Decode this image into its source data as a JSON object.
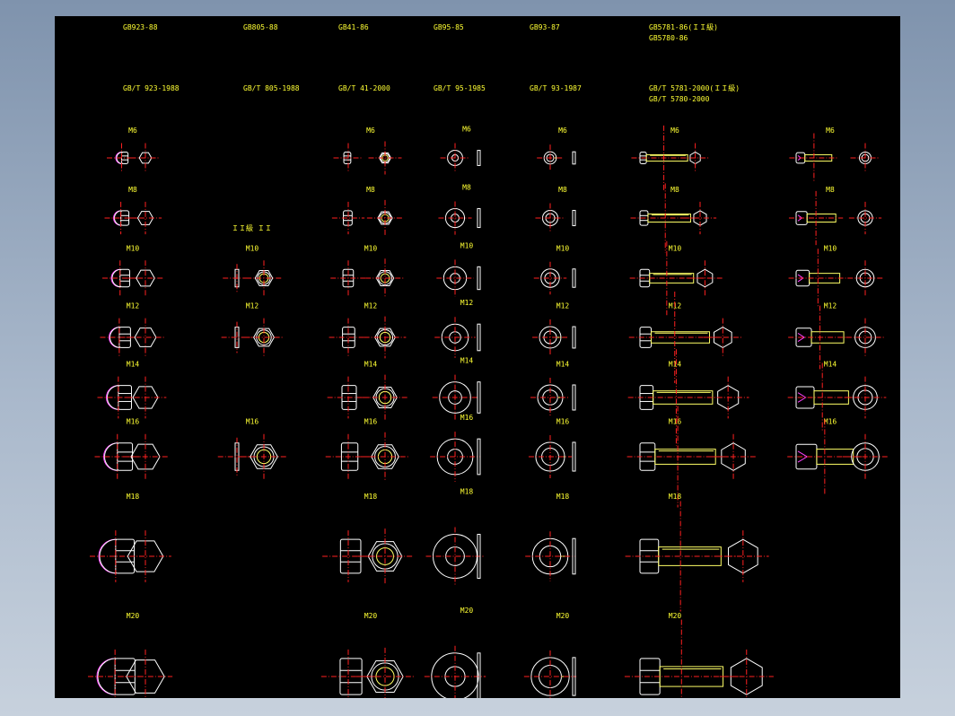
{
  "headers": [
    {
      "line1": "GB923-88",
      "line2": "GB/T 923-1988"
    },
    {
      "line1": "GB805-88",
      "line2": "GB/T 805-1988"
    },
    {
      "line1": "GB41-86",
      "line2": "GB/T 41-2000"
    },
    {
      "line1": "GB95-85",
      "line2": "GB/T 95-1985"
    },
    {
      "line1": "GB93-87",
      "line2": "GB/T 93-1987"
    },
    {
      "line1": "GB5781-86(ＩＩ級)",
      "line1b": "GB5780-86",
      "line2": "GB/T 5781-2000(ＩＩ級)",
      "line2b": "GB/T 5780-2000"
    }
  ],
  "column_note": "ＩＩ級 ＩＩ",
  "sizes": [
    "M6",
    "M8",
    "M10",
    "M12",
    "M14",
    "M16",
    "M18",
    "M20"
  ],
  "columns": [
    {
      "key": "cap_nut",
      "sizes": [
        "M6",
        "M8",
        "M10",
        "M12",
        "M14",
        "M16",
        "M18",
        "M20"
      ]
    },
    {
      "key": "thin_nut",
      "sizes": [
        "M10",
        "M12",
        "M16"
      ]
    },
    {
      "key": "hex_nut",
      "sizes": [
        "M6",
        "M8",
        "M10",
        "M12",
        "M14",
        "M16",
        "M18",
        "M20"
      ]
    },
    {
      "key": "plain_washer",
      "sizes": [
        "M6",
        "M8",
        "M10",
        "M12",
        "M14",
        "M16",
        "M18",
        "M20"
      ]
    },
    {
      "key": "spring_washer",
      "sizes": [
        "M6",
        "M8",
        "M10",
        "M12",
        "M14",
        "M16",
        "M18",
        "M20"
      ]
    },
    {
      "key": "hex_bolt",
      "sizes": [
        "M6",
        "M8",
        "M10",
        "M12",
        "M14",
        "M16",
        "M18",
        "M20"
      ]
    },
    {
      "key": "socket_screw",
      "sizes": [
        "M6",
        "M8",
        "M10",
        "M12",
        "M14",
        "M16"
      ]
    }
  ],
  "colors": {
    "background": "#000000",
    "outline": "#ffffff",
    "label": "#ffff33",
    "centerline": "#ff2020",
    "thread": "#ff40ff",
    "bolt_body": "#ffff66"
  }
}
